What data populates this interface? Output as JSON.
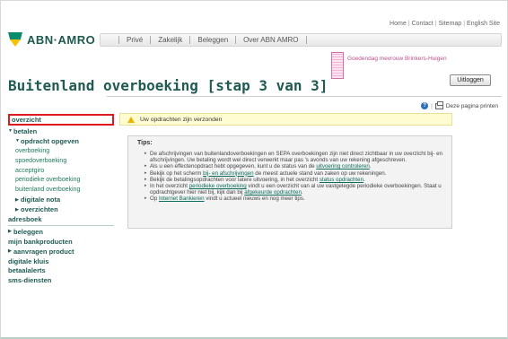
{
  "header": {
    "top_links": [
      "Home",
      "Contact",
      "Sitemap",
      "English Site"
    ],
    "logo_text": "ABN·AMRO",
    "nav_items": [
      "Privé",
      "Zakelijk",
      "Beleggen",
      "Over ABN AMRO"
    ]
  },
  "user": {
    "greeting": "Goedendag mevrouw Brinkers-Huigen",
    "logout_label": "Uitloggen"
  },
  "page": {
    "title": "Buitenland overboeking [stap 3 van 3]",
    "print_label": "Deze pagina printen"
  },
  "sidebar": {
    "overview": "overzicht",
    "payments": "betalen",
    "order_give": "opdracht opgeven",
    "order_items": [
      "overboeking",
      "spoedoverboeking",
      "acceptgiro",
      "periodieke overboeking",
      "buitenland overboeking"
    ],
    "digital_note": "digitale nota",
    "overviews": "overzichten",
    "address_book": "adresboek",
    "invest": "beleggen",
    "my_products": "mijn bankproducten",
    "apply_product": "aanvragen product",
    "digital_vault": "digitale kluis",
    "payment_alerts": "betaalalerts",
    "sms_services": "sms-diensten"
  },
  "notice": {
    "text": "Uw opdrachten zijn verzonden"
  },
  "tips": {
    "title": "Tips:",
    "t1": "De afschrijvingen van buitenlandoverboekingen en SEPA overboekingen zijn niet direct zichtbaar in uw overzicht bij- en afschrijvingen. Uw betaling wordt wel direct verwerkt maar pas 's avonds van uw rekening afgeschreven.",
    "t2_pre": "Als u een effectenopdract hebt opgegeven, kunt u de status van de ",
    "t2_link": "uitvoering controleren",
    "t2_post": ".",
    "t3_pre": "Bekijk op het scherm ",
    "t3_link": "bij- en afschrijvingen",
    "t3_post": " de meest actuele stand van zaken op uw rekeningen.",
    "t4_pre": "Bekijk de betalingsopdrachten voor latere uitvoering, in het overzicht ",
    "t4_link": "status opdrachten",
    "t4_post": ".",
    "t5_pre": "In het overzicht ",
    "t5_link1": "periodieke overboeking",
    "t5_mid": " vindt u een overzicht van al uw vastgelegde periodieke overboekingen. Staat u opdrachtgever hier niet bij, kijk dan bij ",
    "t5_link2": "afgekeurde opdrachten",
    "t5_post": ".",
    "t6_pre": "Op ",
    "t6_link": "Internet Bankieren",
    "t6_post": " vindt u actueel nieuws en nog meer tips."
  },
  "colors": {
    "brand_green": "#1f5a53",
    "link_green": "#1f7a5a",
    "active_border": "#e0191f",
    "notice_bg": "#fffcd2"
  }
}
